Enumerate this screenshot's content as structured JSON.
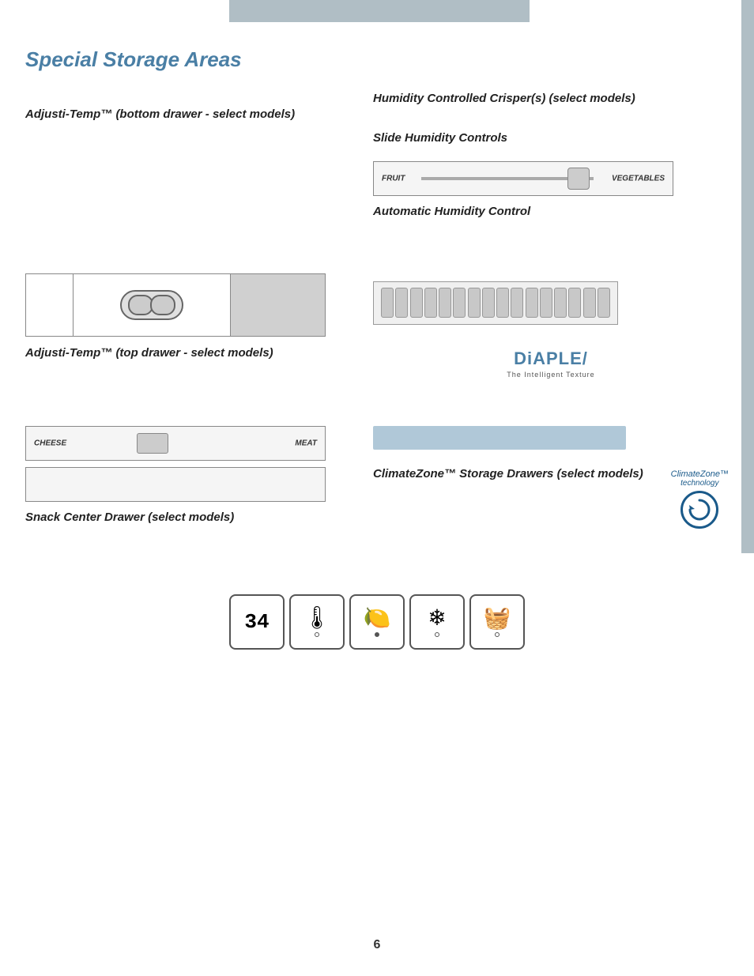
{
  "page": {
    "title": "Special Storage Areas",
    "page_number": "6"
  },
  "right_column": {
    "humidity_title": "Humidity Controlled Crisper(s) (select models)",
    "slide_humidity_title": "Slide Humidity Controls",
    "slider": {
      "left_label": "FRUIT",
      "right_label": "VEGETABLES"
    },
    "auto_humidity_title": "Automatic Humidity Control"
  },
  "left_column": {
    "adjusti_bottom_label": "Adjusti-Temp™ (bottom drawer - select models)",
    "adjusti_top_label": "Adjusti-Temp™ (top drawer - select models)"
  },
  "diaple": {
    "logo": "DiAPLE",
    "slash": "/",
    "subtitle": "The Intelligent Texture"
  },
  "bottom_left": {
    "cheese_label": "CHEESE",
    "meat_label": "MEAT",
    "snack_label": "Snack Center Drawer (select models)"
  },
  "bottom_right": {
    "climate_zone_label": "ClimateZone™ Storage Drawers (select models)",
    "cz_logo_line1": "ClimateZone™",
    "cz_logo_line2": "technology"
  },
  "icons": [
    {
      "type": "temp",
      "value": "34"
    },
    {
      "type": "thermometer"
    },
    {
      "type": "lemon"
    },
    {
      "type": "snowflake"
    },
    {
      "type": "basket"
    }
  ]
}
